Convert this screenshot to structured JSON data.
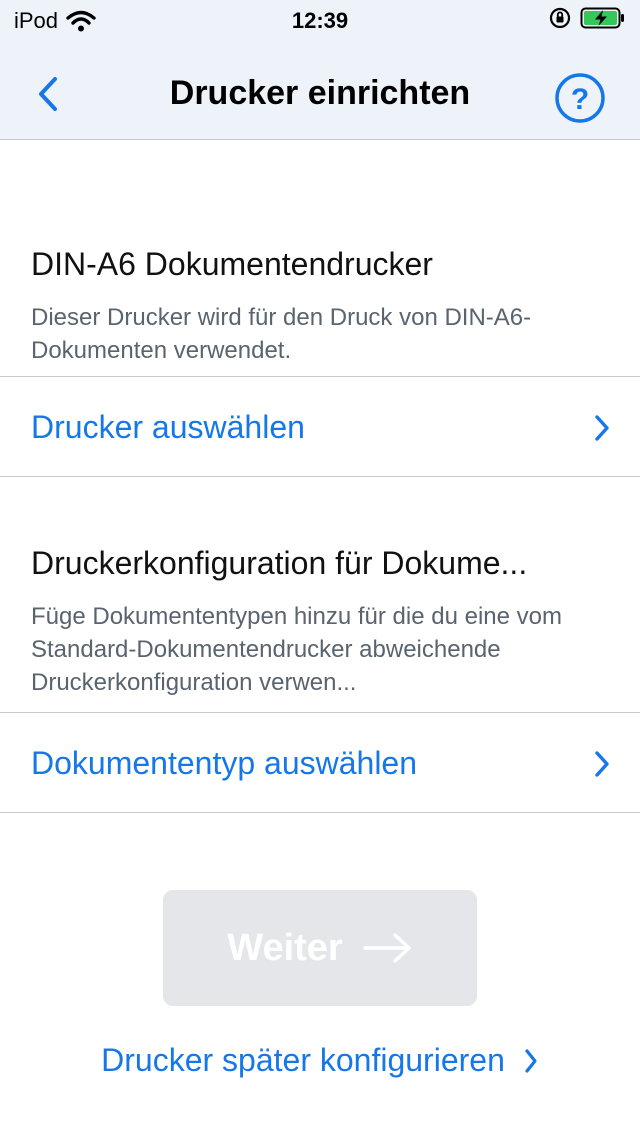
{
  "status_bar": {
    "carrier": "iPod",
    "time": "12:39",
    "icons": [
      "wifi-icon",
      "orientation-lock-icon",
      "battery-charging-icon"
    ]
  },
  "nav": {
    "title": "Drucker einrichten",
    "back_icon": "chevron-left-icon",
    "help_icon": "question-circle-icon"
  },
  "sections": [
    {
      "title": "DIN-A6 Dokumentendrucker",
      "description": "Dieser Drucker wird für den Druck von DIN-A6-Dokumenten verwendet.",
      "action_label": "Drucker auswählen"
    },
    {
      "title": "Druckerkonfiguration für Dokume...",
      "description": "Füge Dokumententypen hinzu für die du eine vom Standard-Dokumentendrucker abweichende Druckerkonfiguration verwen...",
      "action_label": "Dokumententyp auswählen"
    }
  ],
  "buttons": {
    "next_label": "Weiter",
    "later_label": "Drucker später konfigurieren"
  },
  "colors": {
    "accent": "#1677e8",
    "disabled_button": "#e4e6e9",
    "nav_background": "#eef3fa",
    "secondary_text": "#5a646e"
  }
}
